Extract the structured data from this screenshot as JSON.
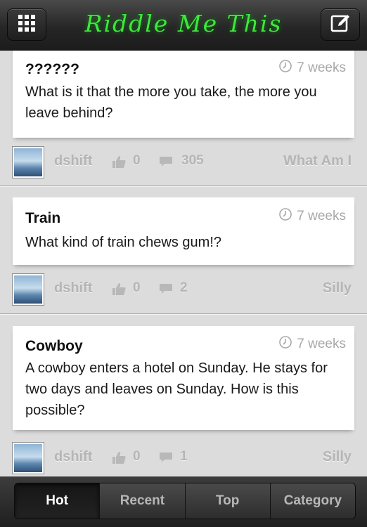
{
  "header": {
    "title": "Riddle Me This",
    "menu_icon": "grid-icon",
    "compose_icon": "compose-icon",
    "title_color": "#3fe63f"
  },
  "posts": [
    {
      "title": "??????",
      "time": "7 weeks",
      "body": "What is it that the more you take, the more you leave behind?",
      "user": "dshift",
      "likes": "0",
      "comments": "305",
      "category": "What Am I"
    },
    {
      "title": "Train",
      "time": "7 weeks",
      "body": "What kind of train chews gum!?",
      "user": "dshift",
      "likes": "0",
      "comments": "2",
      "category": "Silly"
    },
    {
      "title": "Cowboy",
      "time": "7 weeks",
      "body": "A cowboy enters a hotel on Sunday. He stays for two days and leaves on Sunday. How is this possible?",
      "user": "dshift",
      "likes": "0",
      "comments": "1",
      "category": "Silly"
    }
  ],
  "tabs": [
    {
      "label": "Hot",
      "active": true
    },
    {
      "label": "Recent",
      "active": false
    },
    {
      "label": "Top",
      "active": false
    },
    {
      "label": "Category",
      "active": false
    }
  ]
}
